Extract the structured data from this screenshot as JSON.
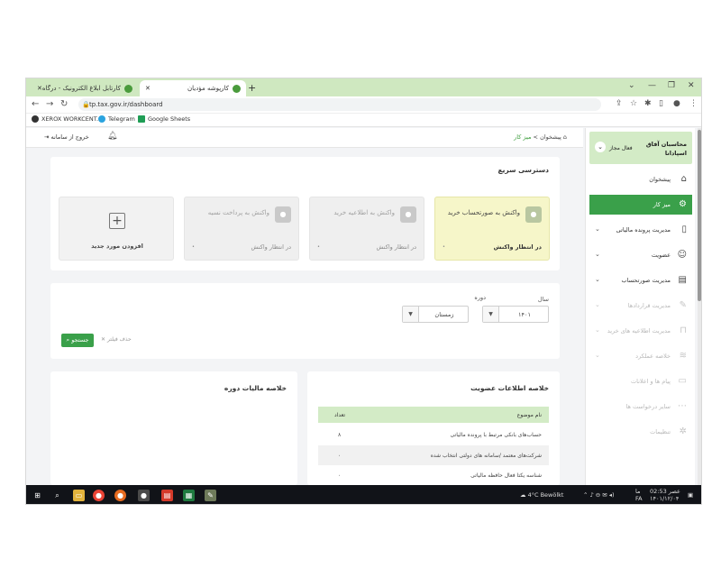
{
  "browser": {
    "tabs": [
      {
        "label": "کارتابل ابلاغ الکترونیک - درگاه ملی"
      },
      {
        "label": "کارپوشه مؤدیان"
      }
    ],
    "new_tab": "+",
    "url": "tp.tax.gov.ir/dashboard",
    "bookmarks": [
      {
        "label": "XEROX WORKCENT..."
      },
      {
        "label": "Telegram"
      },
      {
        "label": "Google Sheets"
      }
    ]
  },
  "header": {
    "logout": "خروج از سامانه",
    "breadcrumb_home": "پیشخوان",
    "breadcrumb_sep": ">",
    "breadcrumb_current": "میز کار"
  },
  "sidebar": {
    "user_name": "محاسبان آفاق اسپادانا",
    "user_role": "فعال مجاز",
    "items": [
      {
        "label": "پیشخوان",
        "icon": "home-icon",
        "glyph": "⌂"
      },
      {
        "label": "میز کار",
        "icon": "desk-icon",
        "glyph": "⚙"
      },
      {
        "label": "مدیریت پرونده مالیاتی",
        "icon": "file-icon",
        "glyph": "▯"
      },
      {
        "label": "عضویت",
        "icon": "user-icon",
        "glyph": "☺"
      },
      {
        "label": "مدیریت صورتحساب",
        "icon": "invoice-icon",
        "glyph": "▤"
      },
      {
        "label": "مدیریت قراردادها",
        "icon": "contract-icon",
        "glyph": "✎"
      },
      {
        "label": "مدیریت اطلاعیه های خرید",
        "icon": "bag-icon",
        "glyph": "⊓"
      },
      {
        "label": "خلاصه عملکرد",
        "icon": "chart-icon",
        "glyph": "≋"
      },
      {
        "label": "پیام ها و اعلانات",
        "icon": "message-icon",
        "glyph": "▭"
      },
      {
        "label": "سایر درخواست ها",
        "icon": "request-icon",
        "glyph": "⋯"
      },
      {
        "label": "تنظیمات",
        "icon": "settings-icon",
        "glyph": "✲"
      }
    ]
  },
  "quick_access": {
    "title": "دسترسی سریع",
    "tiles": [
      {
        "label": "واکنش به صورتحساب خرید",
        "status": "در انتظار واکنش",
        "mark": "•"
      },
      {
        "label": "واکنش به اطلاعیه خرید",
        "status": "در انتظار واکنش",
        "mark": "•"
      },
      {
        "label": "واکنش به پرداخت نسیه",
        "status": "در انتظار واکنش",
        "mark": "•"
      }
    ],
    "add_label": "افزودن مورد جدید"
  },
  "filter": {
    "year_label": "سال",
    "year_value": "۱۴۰۱",
    "period_label": "دوره",
    "period_value": "زمستان",
    "search_label": "جستجو",
    "clear_label": "حذف فیلتر"
  },
  "membership": {
    "title": "خلاصه اطلاعات عضویت",
    "col_topic": "نام موضوع",
    "col_count": "تعداد",
    "rows": [
      {
        "topic": "حساب‌های بانکی مرتبط با پرونده مالیاتی",
        "count": "۸"
      },
      {
        "topic": "شرکت‌های معتمد /سامانه های دولتی انتخاب شده",
        "count": "۰"
      },
      {
        "topic": "شناسه یکتا فعال حافظه مالیاتی",
        "count": "۰"
      }
    ]
  },
  "tax_summary": {
    "title": "خلاصه مالیات دوره"
  },
  "taskbar": {
    "weather": "4°C Bewölkt",
    "lang": "FA",
    "time": "عصر 02:53",
    "date": "۱۴۰۱/۱۲/۰۴",
    "day": "ما"
  },
  "colors": {
    "accent": "#3aa04a",
    "light_green": "#d3ebc6",
    "tile_yellow": "#f6f6c9"
  }
}
